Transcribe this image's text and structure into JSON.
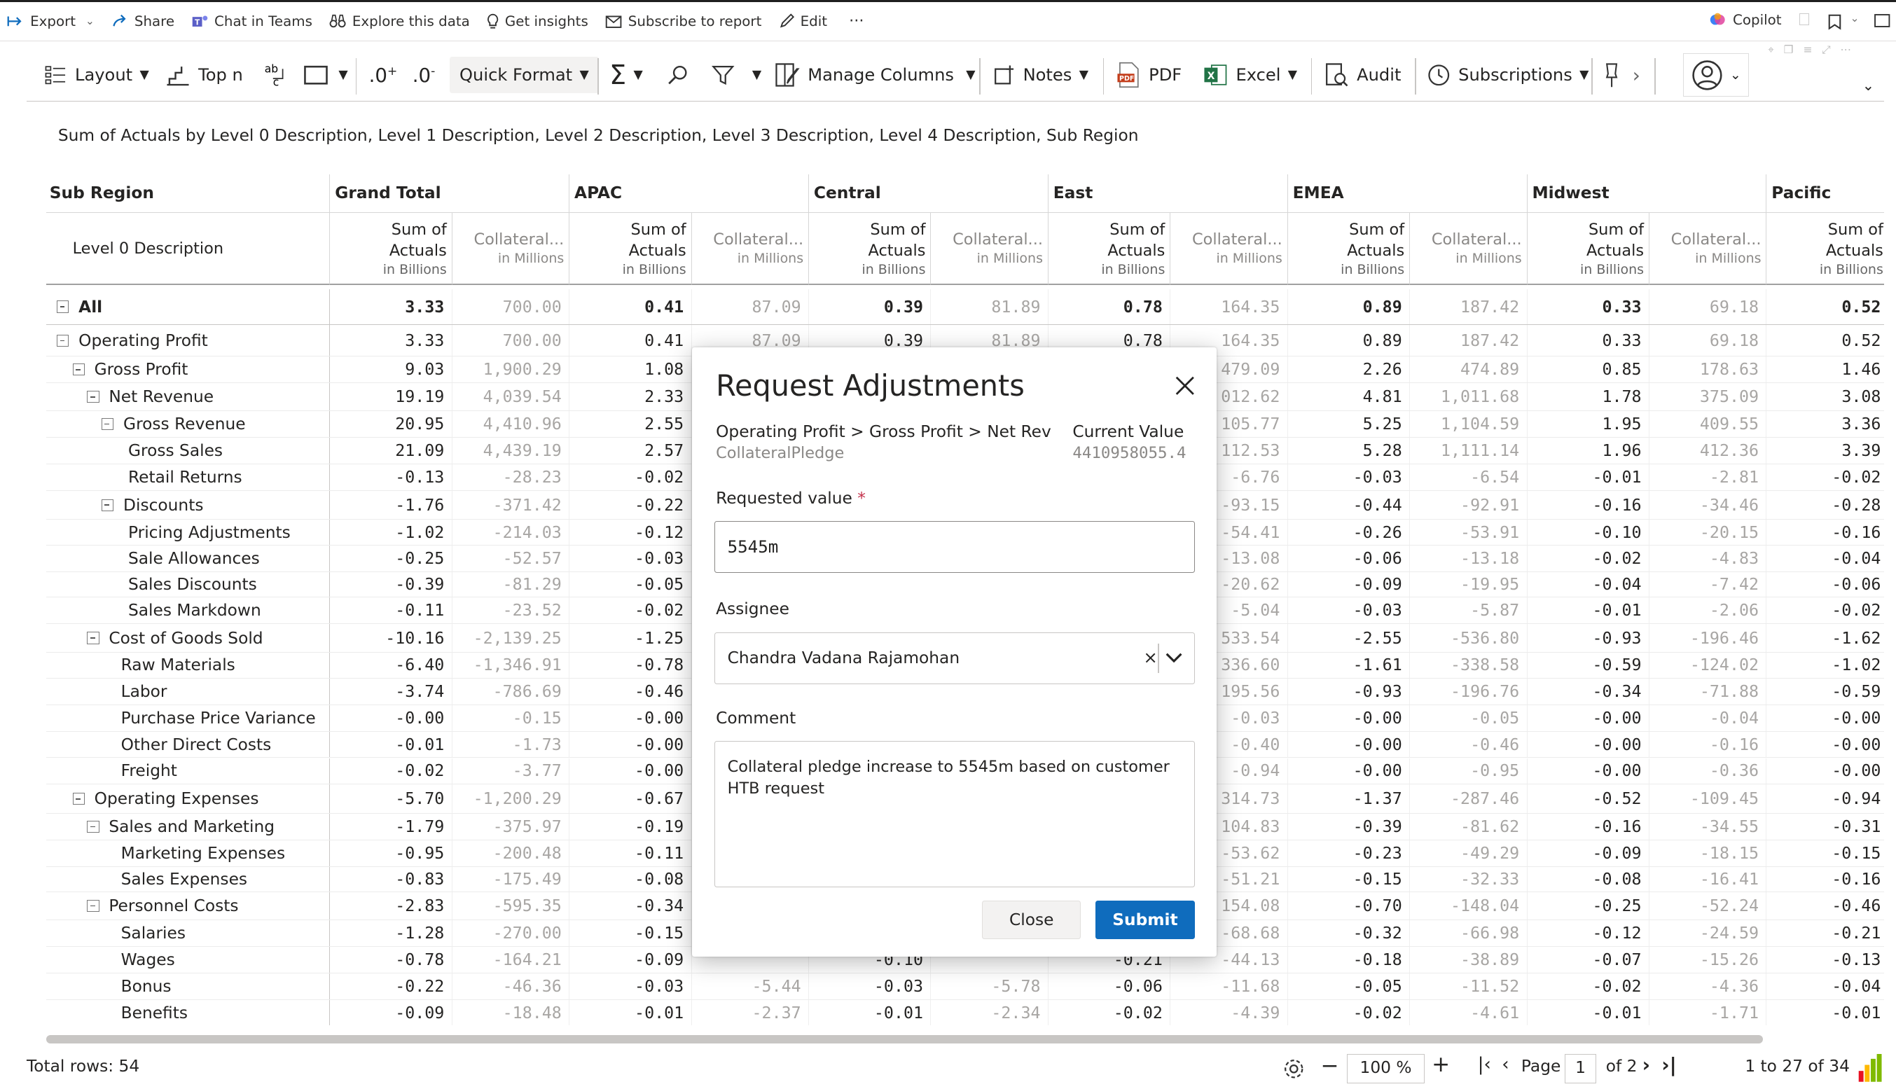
{
  "topbar": {
    "items": [
      {
        "icon": "export-icon",
        "label": "Export"
      },
      {
        "icon": "share-icon",
        "label": "Share"
      },
      {
        "icon": "teams-icon",
        "label": "Chat in Teams"
      },
      {
        "icon": "binoculars-icon",
        "label": "Explore this data"
      },
      {
        "icon": "lightbulb-icon",
        "label": "Get insights"
      },
      {
        "icon": "subscribe-icon",
        "label": "Subscribe to report"
      },
      {
        "icon": "edit-icon",
        "label": "Edit"
      }
    ],
    "more": "···",
    "copilot": "Copilot"
  },
  "toolbar": {
    "layout": "Layout",
    "topn": "Top n",
    "quick_format": "Quick Format",
    "manage_columns": "Manage Columns",
    "notes": "Notes",
    "pdf": "PDF",
    "excel": "Excel",
    "audit": "Audit",
    "subscriptions": "Subscriptions"
  },
  "visual_title": "Sum of Actuals by Level 0 Description, Level 1 Description, Level 2 Description, Level 3 Description, Level 4 Description, Sub Region",
  "table": {
    "corner_header": "Sub Region",
    "row_header": "Level 0 Description",
    "measure_label_1": "Sum of",
    "measure_label_2": "Actuals",
    "measure_unit": "in Billions",
    "coll_label": "Collateral...",
    "coll_unit": "in Millions",
    "regions": [
      "Grand Total",
      "APAC",
      "Central",
      "East",
      "EMEA",
      "Midwest",
      "Pacific"
    ],
    "rows": [
      {
        "label": "All",
        "level": 0,
        "toggle": true,
        "bold": true,
        "v": [
          "3.33",
          "700.00",
          "0.41",
          "87.09",
          "0.39",
          "81.89",
          "0.78",
          "164.35",
          "0.89",
          "187.42",
          "0.33",
          "69.18",
          "0.52"
        ]
      },
      {
        "label": "Operating Profit",
        "level": 0,
        "toggle": true,
        "bold": false,
        "v": [
          "3.33",
          "700.00",
          "0.41",
          "87.09",
          "0.39",
          "81.89",
          "0.78",
          "164.35",
          "0.89",
          "187.42",
          "0.33",
          "69.18",
          "0.52"
        ]
      },
      {
        "label": "Gross Profit",
        "level": 1,
        "toggle": true,
        "bold": false,
        "v": [
          "9.03",
          "1,900.29",
          "1.08",
          "",
          "",
          "",
          "",
          "479.09",
          "2.26",
          "474.89",
          "0.85",
          "178.63",
          "1.46"
        ]
      },
      {
        "label": "Net Revenue",
        "level": 2,
        "toggle": true,
        "bold": false,
        "v": [
          "19.19",
          "4,039.54",
          "2.33",
          "",
          "",
          "",
          "",
          "012.62",
          "4.81",
          "1,011.68",
          "1.78",
          "375.09",
          "3.08"
        ]
      },
      {
        "label": "Gross Revenue",
        "level": 3,
        "toggle": true,
        "bold": false,
        "v": [
          "20.95",
          "4,410.96",
          "2.55",
          "",
          "",
          "",
          "",
          "105.77",
          "5.25",
          "1,104.59",
          "1.95",
          "409.55",
          "3.36"
        ]
      },
      {
        "label": "Gross Sales",
        "level": 4,
        "toggle": false,
        "bold": false,
        "v": [
          "21.09",
          "4,439.19",
          "2.57",
          "",
          "",
          "",
          "",
          "112.53",
          "5.28",
          "1,111.14",
          "1.96",
          "412.36",
          "3.39"
        ]
      },
      {
        "label": "Retail Returns",
        "level": 4,
        "toggle": false,
        "bold": false,
        "v": [
          "-0.13",
          "-28.23",
          "-0.02",
          "",
          "",
          "",
          "",
          "-6.76",
          "-0.03",
          "-6.54",
          "-0.01",
          "-2.81",
          "-0.02"
        ]
      },
      {
        "label": "Discounts",
        "level": 3,
        "toggle": true,
        "bold": false,
        "v": [
          "-1.76",
          "-371.42",
          "-0.22",
          "",
          "",
          "",
          "",
          "-93.15",
          "-0.44",
          "-92.91",
          "-0.16",
          "-34.46",
          "-0.28"
        ]
      },
      {
        "label": "Pricing Adjustments",
        "level": 4,
        "toggle": false,
        "bold": false,
        "v": [
          "-1.02",
          "-214.03",
          "-0.12",
          "",
          "",
          "",
          "",
          "-54.41",
          "-0.26",
          "-53.91",
          "-0.10",
          "-20.15",
          "-0.16"
        ]
      },
      {
        "label": "Sale Allowances",
        "level": 4,
        "toggle": false,
        "bold": false,
        "v": [
          "-0.25",
          "-52.57",
          "-0.03",
          "",
          "",
          "",
          "",
          "-13.08",
          "-0.06",
          "-13.18",
          "-0.02",
          "-4.83",
          "-0.04"
        ]
      },
      {
        "label": "Sales Discounts",
        "level": 4,
        "toggle": false,
        "bold": false,
        "v": [
          "-0.39",
          "-81.29",
          "-0.05",
          "",
          "",
          "",
          "",
          "-20.62",
          "-0.09",
          "-19.95",
          "-0.04",
          "-7.42",
          "-0.06"
        ]
      },
      {
        "label": "Sales Markdown",
        "level": 4,
        "toggle": false,
        "bold": false,
        "v": [
          "-0.11",
          "-23.52",
          "-0.02",
          "",
          "",
          "",
          "",
          "-5.04",
          "-0.03",
          "-5.87",
          "-0.01",
          "-2.06",
          "-0.02"
        ]
      },
      {
        "label": "Cost of Goods Sold",
        "level": 2,
        "toggle": true,
        "bold": false,
        "v": [
          "-10.16",
          "-2,139.25",
          "-1.25",
          "",
          "",
          "",
          "",
          "533.54",
          "-2.55",
          "-536.80",
          "-0.93",
          "-196.46",
          "-1.62"
        ]
      },
      {
        "label": "Raw Materials",
        "level": 3,
        "toggle": false,
        "bold": false,
        "v": [
          "-6.40",
          "-1,346.91",
          "-0.78",
          "",
          "",
          "",
          "",
          "336.60",
          "-1.61",
          "-338.58",
          "-0.59",
          "-124.02",
          "-1.02"
        ]
      },
      {
        "label": "Labor",
        "level": 3,
        "toggle": false,
        "bold": false,
        "v": [
          "-3.74",
          "-786.69",
          "-0.46",
          "",
          "",
          "",
          "",
          "195.56",
          "-0.93",
          "-196.76",
          "-0.34",
          "-71.88",
          "-0.59"
        ]
      },
      {
        "label": "Purchase Price Variance",
        "level": 3,
        "toggle": false,
        "bold": false,
        "v": [
          "-0.00",
          "-0.15",
          "-0.00",
          "",
          "",
          "",
          "",
          "-0.03",
          "-0.00",
          "-0.05",
          "-0.00",
          "-0.04",
          "-0.00"
        ]
      },
      {
        "label": "Other Direct Costs",
        "level": 3,
        "toggle": false,
        "bold": false,
        "v": [
          "-0.01",
          "-1.73",
          "-0.00",
          "",
          "",
          "",
          "",
          "-0.40",
          "-0.00",
          "-0.46",
          "-0.00",
          "-0.16",
          "-0.00"
        ]
      },
      {
        "label": "Freight",
        "level": 3,
        "toggle": false,
        "bold": false,
        "v": [
          "-0.02",
          "-3.77",
          "-0.00",
          "",
          "",
          "",
          "",
          "-0.94",
          "-0.00",
          "-0.95",
          "-0.00",
          "-0.36",
          "-0.00"
        ]
      },
      {
        "label": "Operating Expenses",
        "level": 1,
        "toggle": true,
        "bold": false,
        "v": [
          "-5.70",
          "-1,200.29",
          "-0.67",
          "",
          "",
          "",
          "",
          "314.73",
          "-1.37",
          "-287.46",
          "-0.52",
          "-109.45",
          "-0.94"
        ]
      },
      {
        "label": "Sales and Marketing",
        "level": 2,
        "toggle": true,
        "bold": false,
        "v": [
          "-1.79",
          "-375.97",
          "-0.19",
          "",
          "",
          "",
          "",
          "104.83",
          "-0.39",
          "-81.62",
          "-0.16",
          "-34.55",
          "-0.31"
        ]
      },
      {
        "label": "Marketing Expenses",
        "level": 3,
        "toggle": false,
        "bold": false,
        "v": [
          "-0.95",
          "-200.48",
          "-0.11",
          "",
          "",
          "",
          "",
          "-53.62",
          "-0.23",
          "-49.29",
          "-0.09",
          "-18.15",
          "-0.15"
        ]
      },
      {
        "label": "Sales Expenses",
        "level": 3,
        "toggle": false,
        "bold": false,
        "v": [
          "-0.83",
          "-175.49",
          "-0.08",
          "",
          "",
          "",
          "",
          "-51.21",
          "-0.15",
          "-32.33",
          "-0.08",
          "-16.41",
          "-0.16"
        ]
      },
      {
        "label": "Personnel Costs",
        "level": 2,
        "toggle": true,
        "bold": false,
        "v": [
          "-2.83",
          "-595.35",
          "-0.34",
          "",
          "",
          "",
          "",
          "154.08",
          "-0.70",
          "-148.04",
          "-0.25",
          "-52.24",
          "-0.46"
        ]
      },
      {
        "label": "Salaries",
        "level": 3,
        "toggle": false,
        "bold": false,
        "v": [
          "-1.28",
          "-270.00",
          "-0.15",
          "",
          "",
          "",
          "",
          "-68.68",
          "-0.32",
          "-66.98",
          "-0.12",
          "-24.59",
          "-0.21"
        ]
      },
      {
        "label": "Wages",
        "level": 3,
        "toggle": false,
        "bold": false,
        "v": [
          "-0.78",
          "-164.21",
          "-0.09",
          "",
          "-0.10",
          "",
          "-0.21",
          "-44.13",
          "-0.18",
          "-38.89",
          "-0.07",
          "-15.26",
          "-0.13"
        ]
      },
      {
        "label": "Bonus",
        "level": 3,
        "toggle": false,
        "bold": false,
        "v": [
          "-0.22",
          "-46.36",
          "-0.03",
          "-5.44",
          "-0.03",
          "-5.78",
          "-0.06",
          "-11.68",
          "-0.05",
          "-11.52",
          "-0.02",
          "-4.36",
          "-0.04"
        ]
      },
      {
        "label": "Benefits",
        "level": 3,
        "toggle": false,
        "bold": false,
        "v": [
          "-0.09",
          "-18.48",
          "-0.01",
          "-2.37",
          "-0.01",
          "-2.34",
          "-0.02",
          "-4.39",
          "-0.02",
          "-4.61",
          "-0.01",
          "-1.71",
          "-0.01"
        ]
      }
    ]
  },
  "footer": {
    "total_rows": "Total rows: 54",
    "zoom": "100 %",
    "page_label": "Page",
    "page_value": "1",
    "page_of": "of 2",
    "range": "1 to 27 of 34"
  },
  "dialog": {
    "title": "Request Adjustments",
    "path": "Operating Profit > Gross Profit > Net Reve...",
    "measure": "CollateralPledge",
    "current_label": "Current Value",
    "current_value": "4410958055.4",
    "requested_label": "Requested value",
    "required_mark": "*",
    "requested_value": "5545m",
    "assignee_label": "Assignee",
    "assignee_value": "Chandra Vadana Rajamohan",
    "comment_label": "Comment",
    "comment_value": "Collateral pledge increase to 5545m based on customer HTB request",
    "close_label": "Close",
    "submit_label": "Submit"
  },
  "colors": {
    "accent": "#0f6cbd",
    "text": "#252423",
    "muted": "#a8a6a4",
    "excel": "#217346",
    "pdf": "#c43e1c"
  }
}
